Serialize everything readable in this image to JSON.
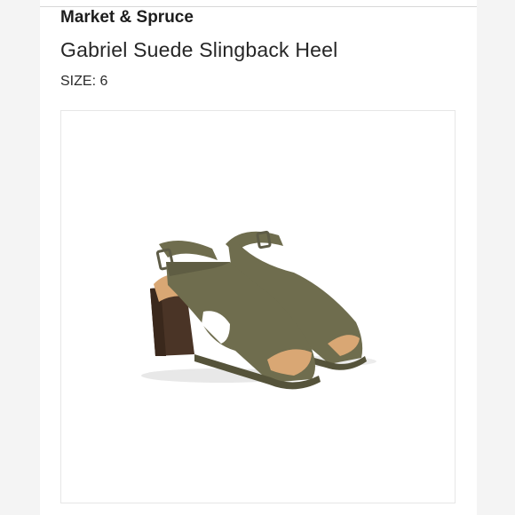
{
  "product": {
    "brand": "Market & Spruce",
    "title": "Gabriel Suede Slingback Heel",
    "size_label": "SIZE: 6",
    "image_alt": "Olive suede slingback block-heel sandals",
    "colors": {
      "suede": "#6f6d4e",
      "suede_dark": "#55533a",
      "lining": "#d9a774",
      "heel": "#4a3426"
    }
  }
}
